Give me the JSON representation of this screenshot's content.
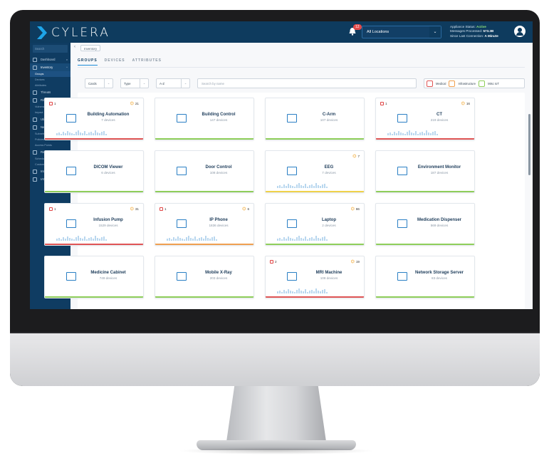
{
  "app": {
    "brand": "CYLERA",
    "notifications_count": "12",
    "location_select": "All Locations",
    "status": {
      "line1_label": "Appliance Status:",
      "line1_value": "Active",
      "line2_label": "Messages Processed:",
      "line2_value": "573.3B",
      "line3_label": "Since Last Connection:",
      "line3_value": "A Minute"
    }
  },
  "sidebar": {
    "search_placeholder": "Search",
    "items": [
      {
        "label": "Dashboard",
        "chevron": "v"
      },
      {
        "label": "Inventory",
        "chevron": "^"
      },
      {
        "label": "Threats",
        "chevron": ""
      },
      {
        "label": "Risk",
        "chevron": "^"
      },
      {
        "label": "Utilization",
        "chevron": ""
      },
      {
        "label": "Network",
        "chevron": "^"
      },
      {
        "label": "Reporting",
        "chevron": "^"
      },
      {
        "label": "Integrations",
        "chevron": ""
      },
      {
        "label": "IAM",
        "chevron": "v"
      }
    ],
    "inventory_sub": [
      "Groups",
      "Devices",
      "Attributes"
    ],
    "risk_sub": [
      "Vulnerabilities",
      "Impact"
    ],
    "network_sub": [
      "Subnets",
      "Policies",
      "Access Points"
    ],
    "reporting_sub": [
      "Scheduled",
      "Custom"
    ]
  },
  "page": {
    "breadcrumb": "Inventory",
    "tabs": [
      "GROUPS",
      "DEVICES",
      "ATTRIBUTES"
    ],
    "filters": {
      "view": "Cards",
      "type": "Type",
      "sort": "A-Z",
      "search_placeholder": "Search by name"
    },
    "legend": [
      "Medical",
      "Infrastructure",
      "Misc IoT"
    ]
  },
  "cards": [
    {
      "name": "Building Automation",
      "sub": "7 devices",
      "alerts": "1",
      "warnings": "21",
      "stripe": "#e05555"
    },
    {
      "name": "Building Control",
      "sub": "147 devices",
      "alerts": "",
      "warnings": "",
      "stripe": "#8fce5a"
    },
    {
      "name": "C-Arm",
      "sub": "107 devices",
      "alerts": "",
      "warnings": "",
      "stripe": "#8fce5a"
    },
    {
      "name": "CT",
      "sub": "219 devices",
      "alerts": "1",
      "warnings": "16",
      "stripe": "#e05555"
    },
    {
      "name": "DICOM Viewer",
      "sub": "6 devices",
      "alerts": "",
      "warnings": "",
      "stripe": "#8fce5a"
    },
    {
      "name": "Door Control",
      "sub": "108 devices",
      "alerts": "",
      "warnings": "",
      "stripe": "#8fce5a"
    },
    {
      "name": "EEG",
      "sub": "7 devices",
      "alerts": "",
      "warnings": "7",
      "stripe": "#f0d24a"
    },
    {
      "name": "Environment Monitor",
      "sub": "187 devices",
      "alerts": "",
      "warnings": "",
      "stripe": "#8fce5a"
    },
    {
      "name": "Infusion Pump",
      "sub": "1529 devices",
      "alerts": "1",
      "warnings": "31",
      "stripe": "#e05555"
    },
    {
      "name": "IP Phone",
      "sub": "1836 devices",
      "alerts": "1",
      "warnings": "6",
      "stripe": "#f0a050"
    },
    {
      "name": "Laptop",
      "sub": "2 devices",
      "alerts": "",
      "warnings": "86",
      "stripe": "#8fce5a"
    },
    {
      "name": "Medication Dispenser",
      "sub": "569 devices",
      "alerts": "",
      "warnings": "",
      "stripe": "#8fce5a"
    },
    {
      "name": "Medicine Cabinet",
      "sub": "749 devices",
      "alerts": "",
      "warnings": "",
      "stripe": "#8fce5a"
    },
    {
      "name": "Mobile X-Ray",
      "sub": "203 devices",
      "alerts": "",
      "warnings": "",
      "stripe": "#8fce5a"
    },
    {
      "name": "MRI Machine",
      "sub": "108 devices",
      "alerts": "2",
      "warnings": "19",
      "stripe": "#e05555"
    },
    {
      "name": "Network Storage Server",
      "sub": "83 devices",
      "alerts": "",
      "warnings": "",
      "stripe": "#8fce5a"
    }
  ],
  "colors": {
    "brand": "#0e3b5e",
    "accent": "#1b8ad8",
    "danger": "#e05555",
    "ok": "#8fce5a",
    "warn": "#f0a020"
  }
}
